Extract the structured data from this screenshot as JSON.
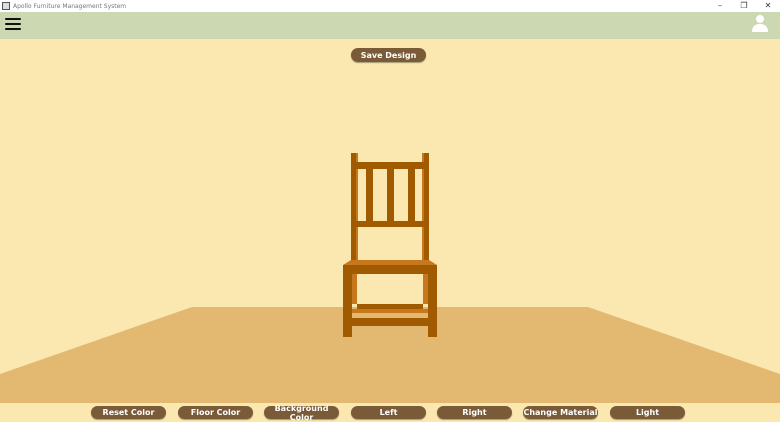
{
  "window": {
    "title": "Apollo Furniture Management System",
    "controls": {
      "minimize": "–",
      "restore": "❐",
      "close": "✕"
    }
  },
  "header": {
    "menu_icon": "hamburger-menu-icon",
    "user_icon": "user-profile-icon"
  },
  "toolbar": {
    "save_label": "Save Design"
  },
  "scene": {
    "background_color": "#fae8b0",
    "floor_color": "#e3b871",
    "chair_color": "#a05a00",
    "chair_highlight": "#c8781c",
    "object": "chair"
  },
  "bottom_toolbar": {
    "reset_color": "Reset Color",
    "floor_color": "Floor Color",
    "background_color": "Background Color",
    "left": "Left",
    "right": "Right",
    "change_material": "Change Material",
    "light": "Light"
  },
  "colors": {
    "header_bg": "#ccd8b1",
    "button_bg": "#7a5b38",
    "button_text": "#ffffff"
  }
}
